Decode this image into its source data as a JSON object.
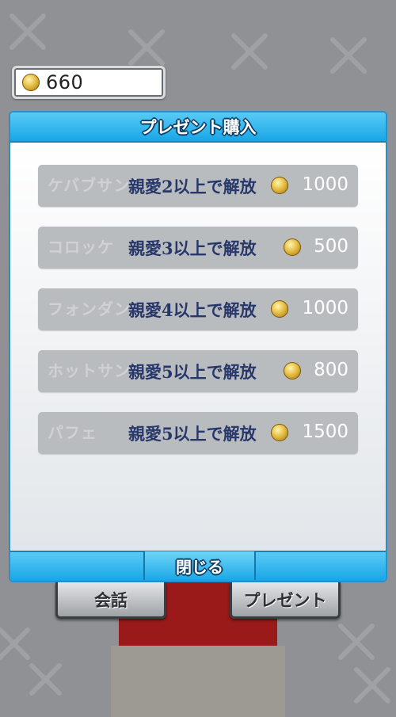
{
  "coins": {
    "value": "660"
  },
  "dialog": {
    "title": "プレゼント購入",
    "close_label": "閉じる",
    "items": [
      {
        "name": "ケバブサンド",
        "lock": "親愛2以上で解放",
        "price": "1000"
      },
      {
        "name": "コロッケ",
        "lock": "親愛3以上で解放",
        "price": "500"
      },
      {
        "name": "フォンダン",
        "lock": "親愛4以上で解放",
        "price": "1000"
      },
      {
        "name": "ホットサンド",
        "lock": "親愛5以上で解放",
        "price": "800"
      },
      {
        "name": "パフェ",
        "lock": "親愛5以上で解放",
        "price": "1500"
      }
    ]
  },
  "buttons": {
    "talk": "会話",
    "present": "プレゼント"
  },
  "colors": {
    "header": "#18a6e6",
    "lock_text": "#27376a",
    "row": "#b9bcbf"
  }
}
